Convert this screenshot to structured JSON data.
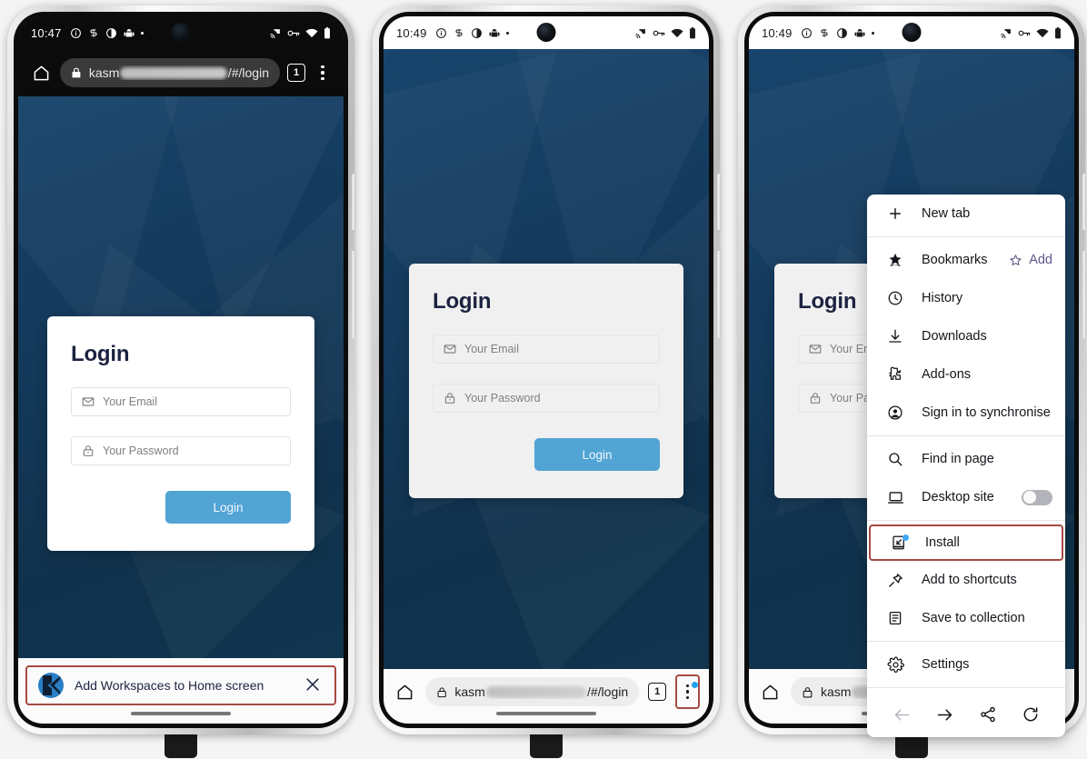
{
  "meta": {
    "scene": "Three Android phone screenshots showing a Kasm Workspaces login page and the Firefox mobile menu with Install highlighted"
  },
  "phones": [
    {
      "id": "phone-1",
      "statusbar": {
        "time": "10:47",
        "theme": "dark",
        "left_icons": [
          "info-icon",
          "silent-icon",
          "contrast-icon",
          "android-icon",
          "dot-icon"
        ],
        "right_icons": [
          "cast-icon",
          "vpn-key-icon",
          "wifi-icon",
          "battery-icon"
        ]
      },
      "toolbar": {
        "position": "top",
        "theme": "dark",
        "home_icon": "home-icon",
        "lock_icon": "lock-icon",
        "url_prefix": "kasm",
        "url_suffix": "/#/login",
        "tab_count": "1",
        "menu_icon": "kebab-menu-icon",
        "menu_badge": false
      },
      "login": {
        "card_theme": "white",
        "title": "Login",
        "email_placeholder": "Your Email",
        "password_placeholder": "Your Password",
        "submit_label": "Login",
        "email_icon": "envelope-icon",
        "password_icon": "lock-icon"
      },
      "pwa_banner": {
        "visible": true,
        "logo": "kasm-logo-icon",
        "text": "Add Workspaces to Home screen",
        "close_icon": "close-icon",
        "highlight_color": "#a64a42"
      }
    },
    {
      "id": "phone-2",
      "statusbar": {
        "time": "10:49",
        "theme": "light",
        "left_icons": [
          "info-icon",
          "silent-icon",
          "contrast-icon",
          "android-icon",
          "dot-icon"
        ],
        "right_icons": [
          "cast-icon",
          "vpn-key-icon",
          "wifi-icon",
          "battery-icon"
        ]
      },
      "toolbar": {
        "position": "bottom",
        "theme": "light",
        "home_icon": "home-icon",
        "lock_icon": "lock-icon",
        "url_prefix": "kasm",
        "url_suffix": "/#/login",
        "tab_count": "1",
        "menu_icon": "kebab-menu-icon",
        "menu_badge": true,
        "menu_highlight_color": "#a64a42"
      },
      "login": {
        "card_theme": "grey",
        "title": "Login",
        "email_placeholder": "Your Email",
        "password_placeholder": "Your Password",
        "submit_label": "Login",
        "email_icon": "envelope-icon",
        "password_icon": "lock-icon"
      },
      "pwa_banner": {
        "visible": false
      }
    },
    {
      "id": "phone-3",
      "statusbar": {
        "time": "10:49",
        "theme": "light",
        "left_icons": [
          "info-icon",
          "silent-icon",
          "contrast-icon",
          "android-icon",
          "dot-icon"
        ],
        "right_icons": [
          "cast-icon",
          "vpn-key-icon",
          "wifi-icon",
          "battery-icon"
        ]
      },
      "toolbar": {
        "position": "bottom",
        "theme": "light",
        "home_icon": "home-icon",
        "lock_icon": "lock-icon",
        "url_prefix": "kasm",
        "url_suffix": "",
        "tab_count": "",
        "menu_icon": "kebab-menu-icon",
        "menu_badge": false
      },
      "login": {
        "card_theme": "grey",
        "title": "Login",
        "email_placeholder": "Your Em",
        "password_placeholder": "Your Pa",
        "submit_label": "",
        "email_icon": "envelope-icon",
        "password_icon": "lock-icon"
      },
      "pwa_banner": {
        "visible": false
      }
    }
  ],
  "firefox_menu": {
    "items": [
      {
        "label": "New tab",
        "icon": "plus-icon",
        "trailing": "",
        "highlighted": false,
        "badge": false
      },
      {
        "label": "Bookmarks",
        "icon": "bookmark-star-icon",
        "trailing": "Add",
        "trailing_icon": "star-outline-icon",
        "highlighted": false,
        "badge": false
      },
      {
        "label": "History",
        "icon": "clock-icon",
        "trailing": "",
        "highlighted": false,
        "badge": false
      },
      {
        "label": "Downloads",
        "icon": "download-icon",
        "trailing": "",
        "highlighted": false,
        "badge": false
      },
      {
        "label": "Add-ons",
        "icon": "puzzle-piece-icon",
        "trailing": "",
        "highlighted": false,
        "badge": false
      },
      {
        "label": "Sign in to synchronise",
        "icon": "account-circle-icon",
        "trailing": "",
        "highlighted": false,
        "badge": false
      },
      {
        "label": "Find in page",
        "icon": "search-icon",
        "trailing": "",
        "highlighted": false,
        "badge": false
      },
      {
        "label": "Desktop site",
        "icon": "laptop-icon",
        "trailing": "toggle",
        "toggle_on": false,
        "highlighted": false,
        "badge": false
      },
      {
        "label": "Install",
        "icon": "install-app-icon",
        "trailing": "",
        "highlighted": true,
        "badge": true
      },
      {
        "label": "Add to shortcuts",
        "icon": "pin-icon",
        "trailing": "",
        "highlighted": false,
        "badge": false
      },
      {
        "label": "Save to collection",
        "icon": "collection-icon",
        "trailing": "",
        "highlighted": false,
        "badge": false
      },
      {
        "label": "Settings",
        "icon": "gear-icon",
        "trailing": "",
        "highlighted": false,
        "badge": false
      }
    ],
    "nav": [
      {
        "icon": "arrow-back-icon",
        "enabled": false
      },
      {
        "icon": "arrow-forward-icon",
        "enabled": true
      },
      {
        "icon": "share-icon",
        "enabled": true
      },
      {
        "icon": "reload-icon",
        "enabled": true
      }
    ],
    "add_link_label": "Add",
    "accent_color": "#5b5687",
    "highlight_color": "#a64a42"
  }
}
